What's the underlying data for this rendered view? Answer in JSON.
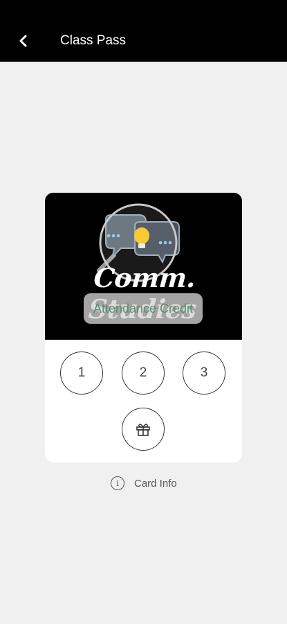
{
  "app_bar": {
    "title": "Class Pass",
    "back_icon": "chevron-left-icon"
  },
  "card": {
    "brand_text": "Comm. Studies",
    "credit_label": "Attendance Credit",
    "stamps": [
      "1",
      "2",
      "3"
    ],
    "reward_icon": "gift-icon",
    "colors": {
      "header_bg": "#000000",
      "card_bg": "#ffffff",
      "credit_text": "#5a8b6f",
      "bulb": "#f7c51c",
      "bubble_dots": "#8ec5e8"
    }
  },
  "card_info": {
    "icon": "info-icon",
    "label": "Card Info"
  }
}
